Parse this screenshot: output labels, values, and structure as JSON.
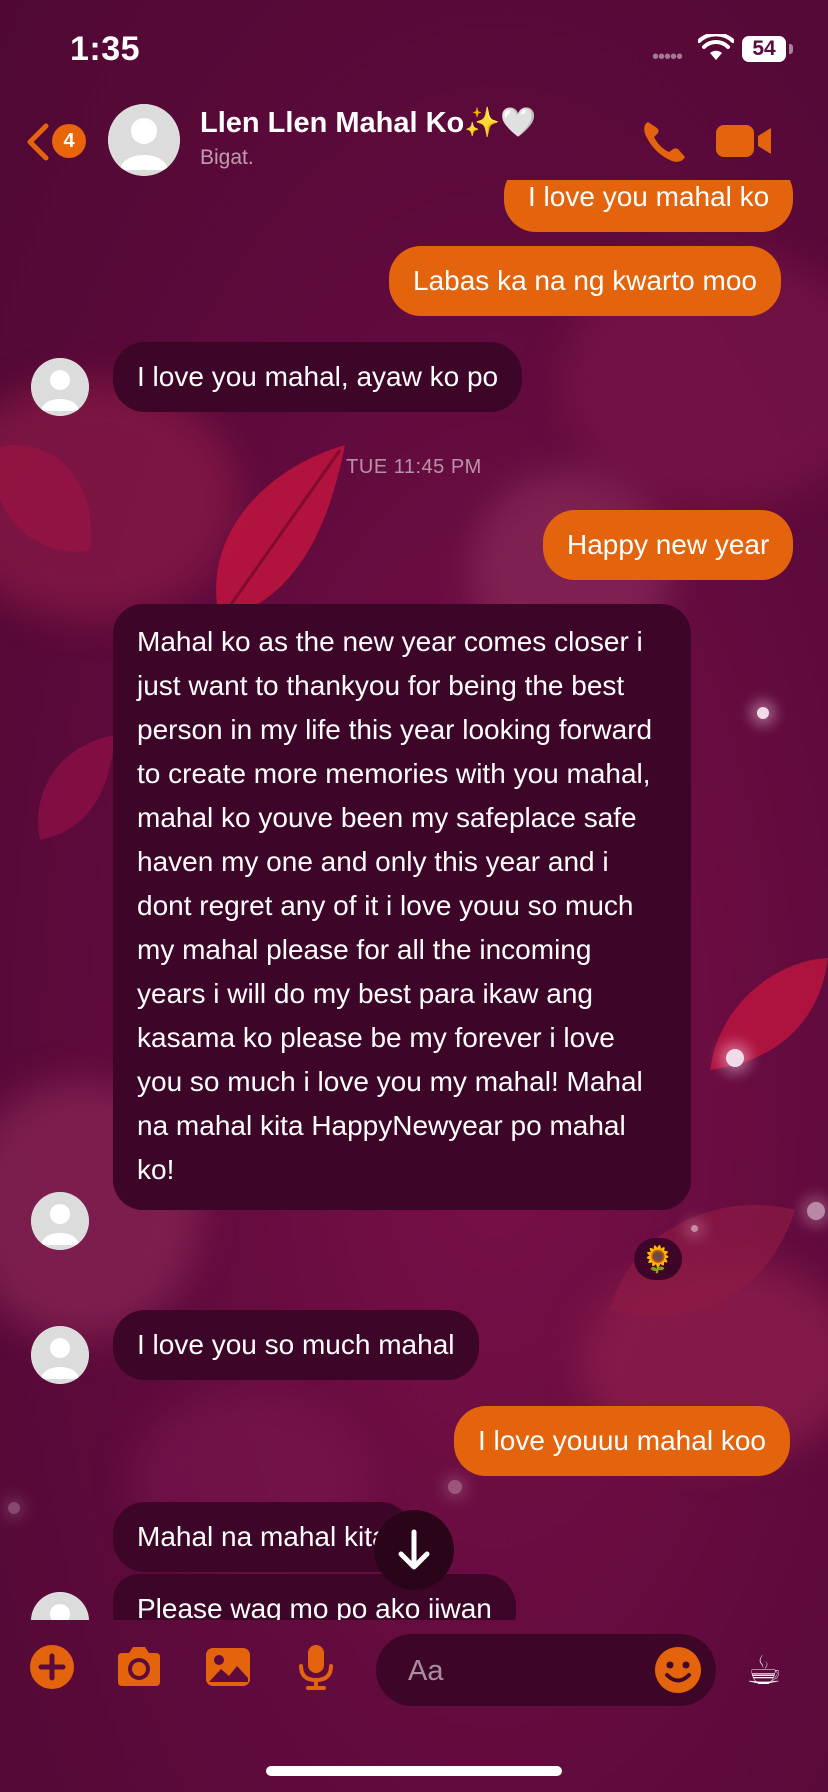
{
  "status_bar": {
    "time": "1:35",
    "dots": "•••••",
    "battery": "54"
  },
  "header": {
    "back_badge": "4",
    "contact_name": "Llen Llen Mahal Ko✨🤍",
    "contact_subtitle": "Bigat."
  },
  "chat": {
    "timestamp": "TUE 11:45 PM",
    "messages": [
      {
        "direction": "outgoing",
        "text": "I love you mahal ko"
      },
      {
        "direction": "outgoing",
        "text": "Labas ka na ng kwarto moo"
      },
      {
        "direction": "incoming",
        "text": "I love you mahal, ayaw ko po"
      },
      {
        "direction": "outgoing",
        "text": "Happy new year"
      },
      {
        "direction": "incoming",
        "text": "Mahal ko as the new year comes closer i just want to thankyou for being the best person in my life this year looking forward to create more memories with you mahal, mahal ko youve been my safeplace safe haven my one and only this year and i dont regret any of it i love youu so much my mahal please for all the incoming years i will do my best para ikaw ang kasama ko please be my forever i love you so much i love you my mahal! Mahal na mahal kita HappyNewyear po mahal ko!",
        "reaction": "🌻"
      },
      {
        "direction": "incoming",
        "text": "I love you so much mahal"
      },
      {
        "direction": "outgoing",
        "text": "I love youuu mahal koo"
      },
      {
        "direction": "incoming",
        "text": "Mahal na mahal kita"
      },
      {
        "direction": "incoming",
        "text": "Please wag mo po ako iiwan"
      }
    ]
  },
  "composer": {
    "placeholder": "Aa",
    "sticker": "☕"
  },
  "icons": {
    "back": "chevron-left-icon",
    "call": "phone-icon",
    "video": "video-camera-icon",
    "plus": "plus-circle-icon",
    "camera": "camera-icon",
    "gallery": "image-icon",
    "mic": "microphone-icon",
    "emoji": "smiley-icon",
    "scroll": "arrow-down-icon"
  },
  "colors": {
    "accent": "#e3640c",
    "incoming_bubble": "#3d0628",
    "background": "#5e0a3c"
  }
}
